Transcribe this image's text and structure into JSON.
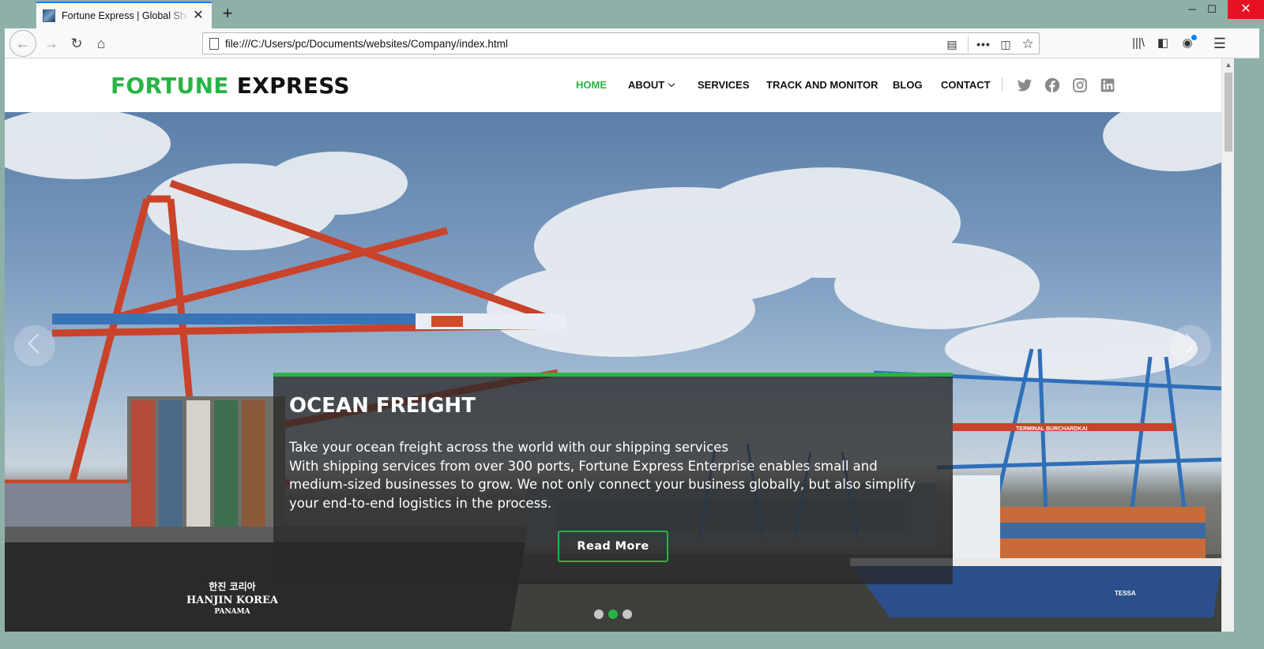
{
  "browser": {
    "tab_title": "Fortune Express | Global Shipping",
    "url": "file:///C:/Users/pc/Documents/websites/Company/index.html",
    "accent": "#0a84ff"
  },
  "site": {
    "logo_part1": "FORTUNE",
    "logo_part2": "EXPRESS",
    "brand_color": "#28b445",
    "nav": {
      "home": "HOME",
      "about": "ABOUT",
      "services": "SERVICES",
      "track": "TRACK AND MONITOR",
      "blog": "BLOG",
      "contact": "CONTACT"
    },
    "social_icons": [
      "twitter-icon",
      "facebook-icon",
      "instagram-icon",
      "linkedin-icon"
    ]
  },
  "hero": {
    "title": "OCEAN FREIGHT",
    "line1": "Take your ocean freight across the world with our shipping services",
    "line2": "With shipping services from over 300 ports, Fortune Express Enterprise enables small and medium-sized businesses to grow. We not only connect your business globally, but also simplify your end-to-end logistics in the process.",
    "button": "Read More",
    "ship_left_name": "HANJIN KOREA",
    "ship_left_korean": "한진 코리아",
    "ship_left_port": "PANAMA",
    "terminal_sign": "TERMINAL BURCHARDKAI",
    "ship_right_name": "TESSA",
    "slides_total": 3,
    "active_slide": 2
  }
}
